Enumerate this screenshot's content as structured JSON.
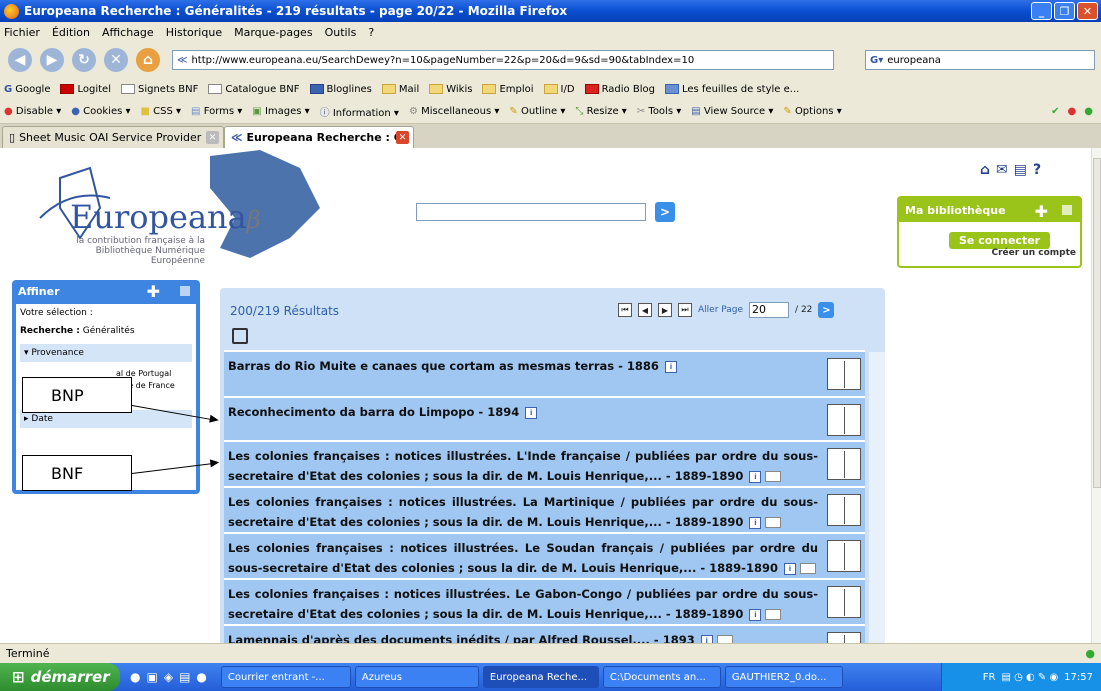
{
  "window": {
    "title": "Europeana Recherche : Généralités - 219 résultats - page 20/22 - Mozilla Firefox"
  },
  "menu": [
    "Fichier",
    "Édition",
    "Affichage",
    "Historique",
    "Marque-pages",
    "Outils",
    "?"
  ],
  "urlbar": {
    "value": "http://www.europeana.eu/SearchDewey?n=10&pageNumber=22&p=20&d=9&sd=90&tabIndex=10"
  },
  "searchbar": {
    "value": "europeana"
  },
  "bookmarks": [
    "Google",
    "Logitel",
    "Signets BNF",
    "Catalogue BNF",
    "Bloglines",
    "Mail",
    "Wikis",
    "Emploi",
    "I/D",
    "Radio Blog",
    "Les feuilles de style e..."
  ],
  "devtoolbar": [
    "Disable",
    "Cookies",
    "CSS",
    "Forms",
    "Images",
    "Information",
    "Miscellaneous",
    "Outline",
    "Resize",
    "Tools",
    "View Source",
    "Options"
  ],
  "tabs": [
    {
      "label": "Sheet Music OAI Service Provider"
    },
    {
      "label": "Europeana Recherche : Généralit..."
    }
  ],
  "site": {
    "logo": "Europeana",
    "logo_beta": "β",
    "logo_sub": "la contribution française à la Bibliothèque Numérique Européenne",
    "search_go": ">",
    "top_icons": [
      "⌂",
      "✉",
      "▤",
      "?"
    ],
    "mybib": {
      "title": "Ma bibliothèque",
      "connect": "Se connecter",
      "account": "Créer un compte"
    }
  },
  "affiner": {
    "title": "Affiner",
    "selection_label": "Votre sélection :",
    "search_label": "Recherche :",
    "search_value": "Généralités",
    "provenance": "Provenance",
    "provenance_items": [
      "al de Portugal",
      "nale de France"
    ],
    "date": "Date"
  },
  "annotations": [
    {
      "label": "BNP"
    },
    {
      "label": "BNF"
    }
  ],
  "results": {
    "count": "200/219 Résultats",
    "pager_label": "Aller Page",
    "page": "20",
    "total": "/ 22",
    "items": [
      {
        "title": "Barras do Rio Muite e canaes que cortam as mesmas terras - 1886",
        "folder": false
      },
      {
        "title": "Reconhecimento da barra do Limpopo - 1894",
        "folder": false
      },
      {
        "title": "Les colonies françaises : notices illustrées. L'Inde française / publiées par ordre du sous-secretaire d'Etat des colonies ; sous la dir. de M. Louis Henrique,... - 1889-1890",
        "folder": true
      },
      {
        "title": "Les colonies françaises : notices illustrées. La Martinique / publiées par ordre du sous-secretaire d'Etat des colonies ; sous la dir. de M. Louis Henrique,... - 1889-1890",
        "folder": true
      },
      {
        "title": "Les colonies françaises : notices illustrées. Le Soudan français / publiées par ordre du sous-secretaire d'Etat des colonies ; sous la dir. de M. Louis Henrique,... - 1889-1890",
        "folder": true
      },
      {
        "title": "Les colonies françaises : notices illustrées. Le Gabon-Congo / publiées par ordre du sous-secretaire d'Etat des colonies ; sous la dir. de M. Louis Henrique,... - 1889-1890",
        "folder": true
      },
      {
        "title": "Lamennais d'après des documents inédits / par Alfred Roussel,... - 1893",
        "folder": true
      }
    ]
  },
  "status": "Terminé",
  "taskbar": {
    "start": "démarrer",
    "items": [
      "Courrier entrant -...",
      "Azureus",
      "Europeana Reche...",
      "C:\\Documents an...",
      "GAUTHIER2_0.do..."
    ],
    "lang": "FR",
    "clock": "17:57"
  }
}
